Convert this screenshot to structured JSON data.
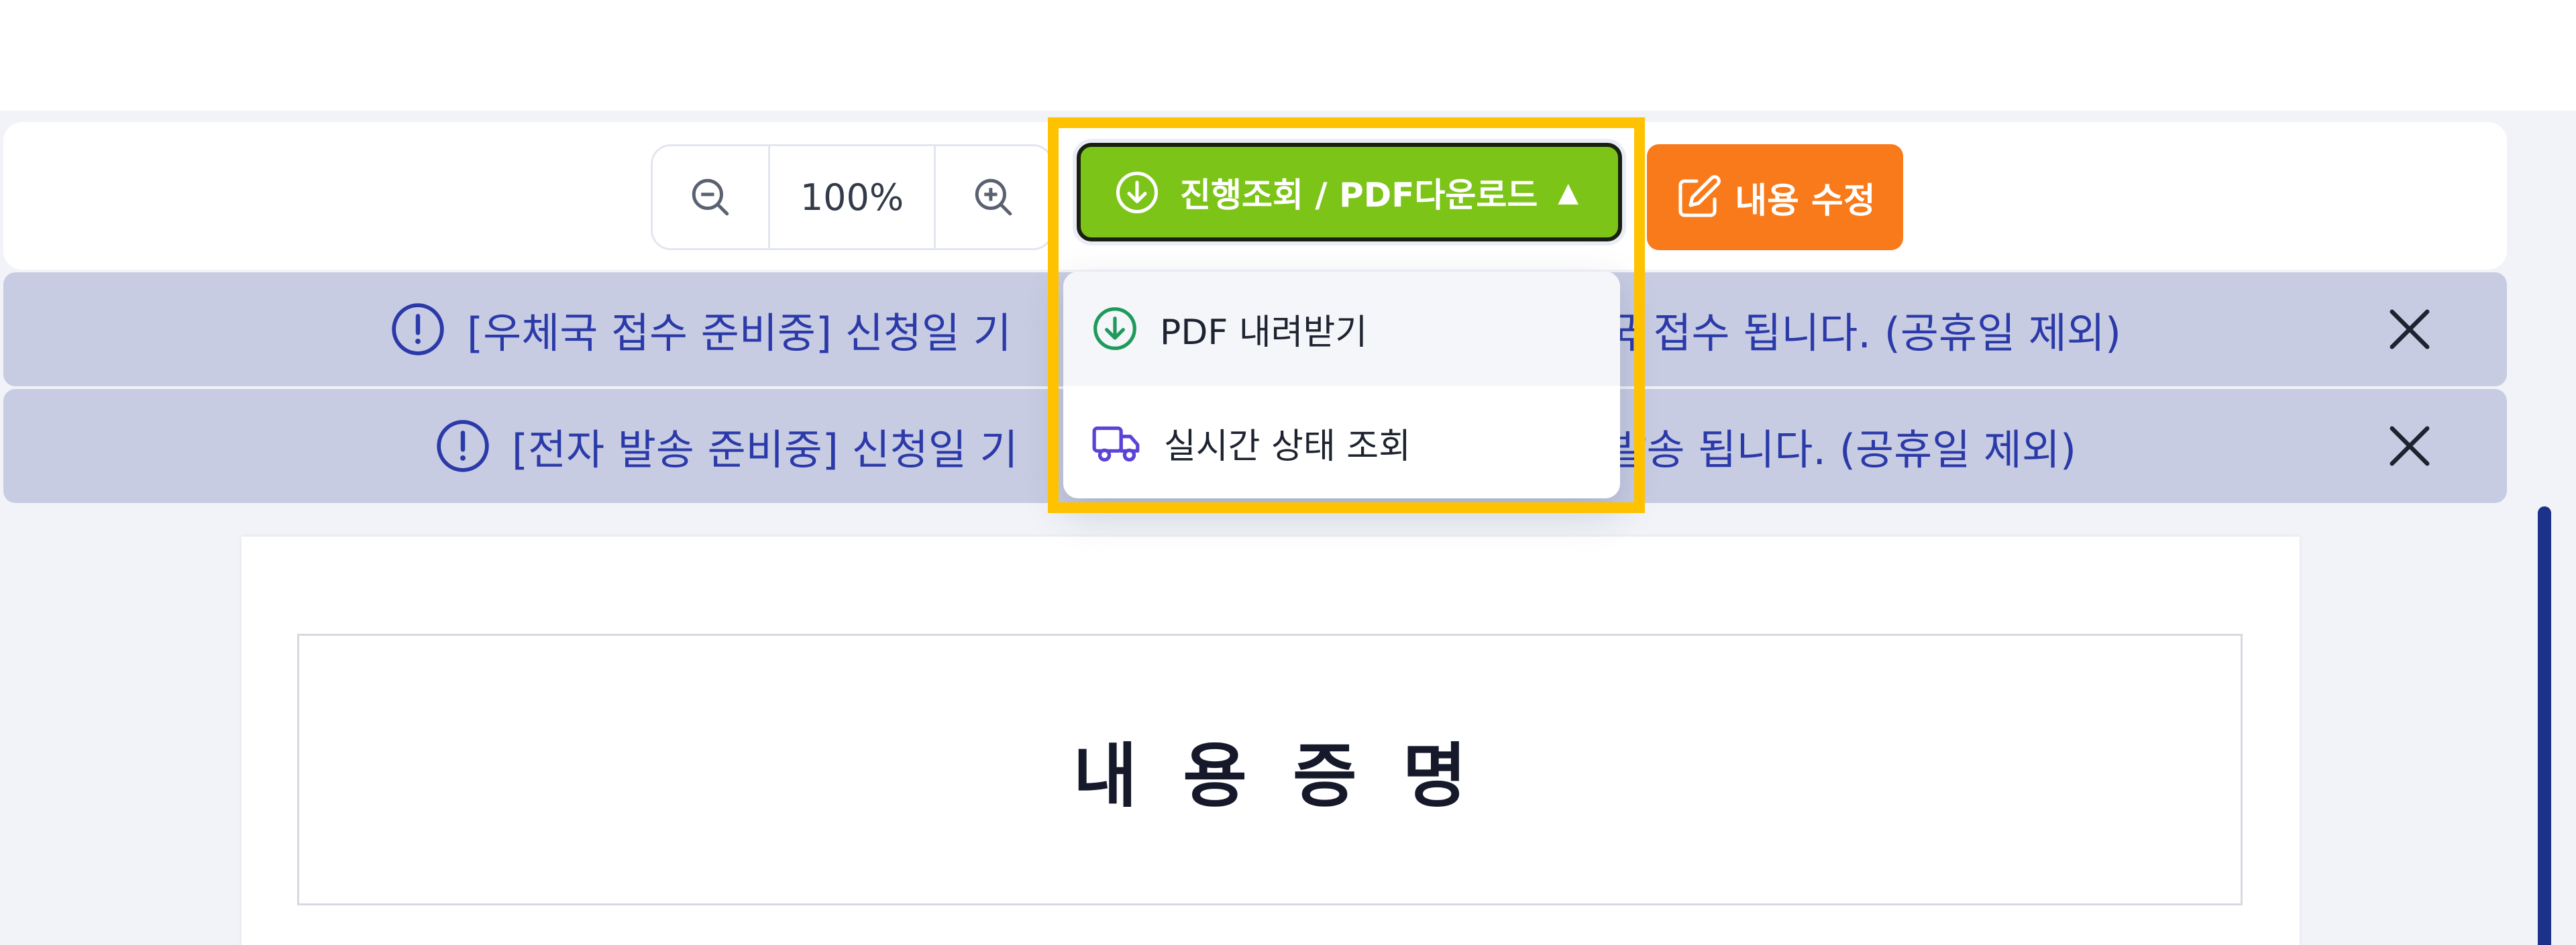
{
  "toolbar": {
    "zoom_out_icon": "zoom-out-icon",
    "zoom_value": "100%",
    "zoom_in_icon": "zoom-in-icon",
    "progress_button_label": "진행조회 / PDF다운로드",
    "progress_button_caret": "▲",
    "edit_button_label": "내용 수정"
  },
  "dropdown": {
    "items": [
      {
        "icon": "download-circle-icon",
        "label": "PDF 내려받기"
      },
      {
        "icon": "truck-icon",
        "label": "실시간 상태 조회"
      }
    ]
  },
  "alerts": [
    {
      "left_text": "[우체국 접수 준비중] 신청일 기",
      "right_text": "국 접수 됩니다. (공휴일 제외)"
    },
    {
      "left_text": "[전자 발송 준비중] 신청일 기",
      "right_text": "발송 됩니다. (공휴일 제외)"
    }
  ],
  "document": {
    "title": "내용증명"
  },
  "colors": {
    "progress_button": "#7cc417",
    "edit_button": "#f97a1a",
    "alert_background": "#c7cce3",
    "alert_text": "#2b3aa8",
    "highlight": "#ffc200"
  }
}
